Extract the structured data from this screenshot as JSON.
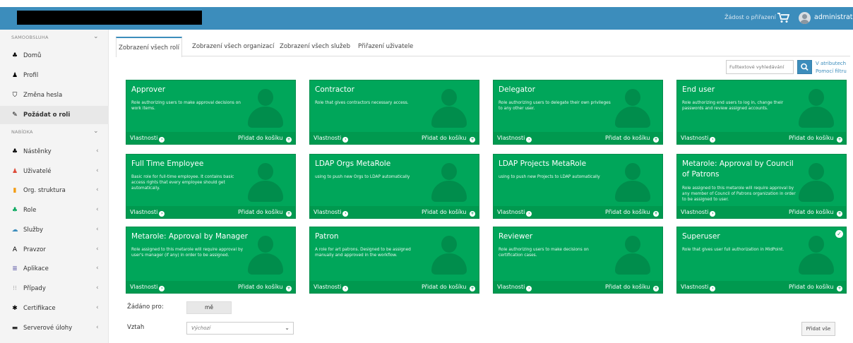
{
  "header": {
    "request_link": "Žádost o přiřazení",
    "username": "administrator"
  },
  "sidebar": {
    "section_self": "SAMOOBSLUHA",
    "self_items": [
      {
        "label": "Domů",
        "icon": "dashboard-icon"
      },
      {
        "label": "Profil",
        "icon": "user-icon"
      },
      {
        "label": "Změna hesla",
        "icon": "shield-icon"
      },
      {
        "label": "Požádat o roli",
        "icon": "edit-icon"
      }
    ],
    "section_menu": "NABÍDKA",
    "menu_items": [
      {
        "label": "Nástěnky",
        "icon": "dashboard-icon"
      },
      {
        "label": "Uživatelé",
        "icon": "user-icon"
      },
      {
        "label": "Org. struktura",
        "icon": "building-icon"
      },
      {
        "label": "Role",
        "icon": "street-view-icon"
      },
      {
        "label": "Služby",
        "icon": "cloud-icon"
      },
      {
        "label": "Pravzor",
        "icon": "archetype-icon"
      },
      {
        "label": "Aplikace",
        "icon": "database-icon"
      },
      {
        "label": "Případy",
        "icon": "cases-icon"
      },
      {
        "label": "Certifikace",
        "icon": "certificate-icon"
      },
      {
        "label": "Serverové úlohy",
        "icon": "tasks-icon"
      }
    ]
  },
  "tabs": [
    {
      "label": "Zobrazení všech rolí"
    },
    {
      "label": "Zobrazení všech organizací"
    },
    {
      "label": "Zobrazení všech služeb"
    },
    {
      "label": "Přiřazení uživatele"
    }
  ],
  "search": {
    "placeholder": "Fulltextové vyhledávání",
    "link_attr": "V atributech",
    "link_help": "Pomocí filtru"
  },
  "card_labels": {
    "properties": "Vlastnosti",
    "add_to_cart": "Přidat do košíku"
  },
  "roles": [
    {
      "title": "Approver",
      "desc": "Role authorizing users to make approval decisions on work items."
    },
    {
      "title": "Contractor",
      "desc": "Role that gives contractors necessary access."
    },
    {
      "title": "Delegator",
      "desc": "Role authorizing users to delegate their own privileges to any other user."
    },
    {
      "title": "End user",
      "desc": "Role authorizing end users to log in, change their passwords and review assigned accounts."
    },
    {
      "title": "Full Time Employee",
      "desc": "Basic role for full-time employee. It contains basic access rights that every employee should get automatically."
    },
    {
      "title": "LDAP Orgs MetaRole",
      "desc": "using to push new Orgs to LDAP automatically"
    },
    {
      "title": "LDAP Projects MetaRole",
      "desc": "using to push new Projects to LDAP automatically"
    },
    {
      "title": "Metarole: Approval by Council of Patrons",
      "desc": "Role assigned to this metarole will require approval by any member of Council of Patrons organization in order to be assigned to user."
    },
    {
      "title": "Metarole: Approval by Manager",
      "desc": "Role assigned to this metarole will require approval by user's manager (if any) in order to be assigned."
    },
    {
      "title": "Patron",
      "desc": "A role for art patrons. Designed to be assigned manually and approved in the workflow."
    },
    {
      "title": "Reviewer",
      "desc": "Role authorizing users to make decisions on certification cases."
    },
    {
      "title": "Superuser",
      "desc": "Role that gives user full authorization in MidPoint.",
      "selected": true
    }
  ],
  "form": {
    "requested_for_label": "Žádáno pro:",
    "requested_for_value": "mě",
    "relation_label": "Vztah",
    "relation_value": "Výchozí",
    "add_all": "Přidat vše"
  },
  "colors": {
    "header": "#3c8dbc",
    "card": "#00a65a"
  }
}
